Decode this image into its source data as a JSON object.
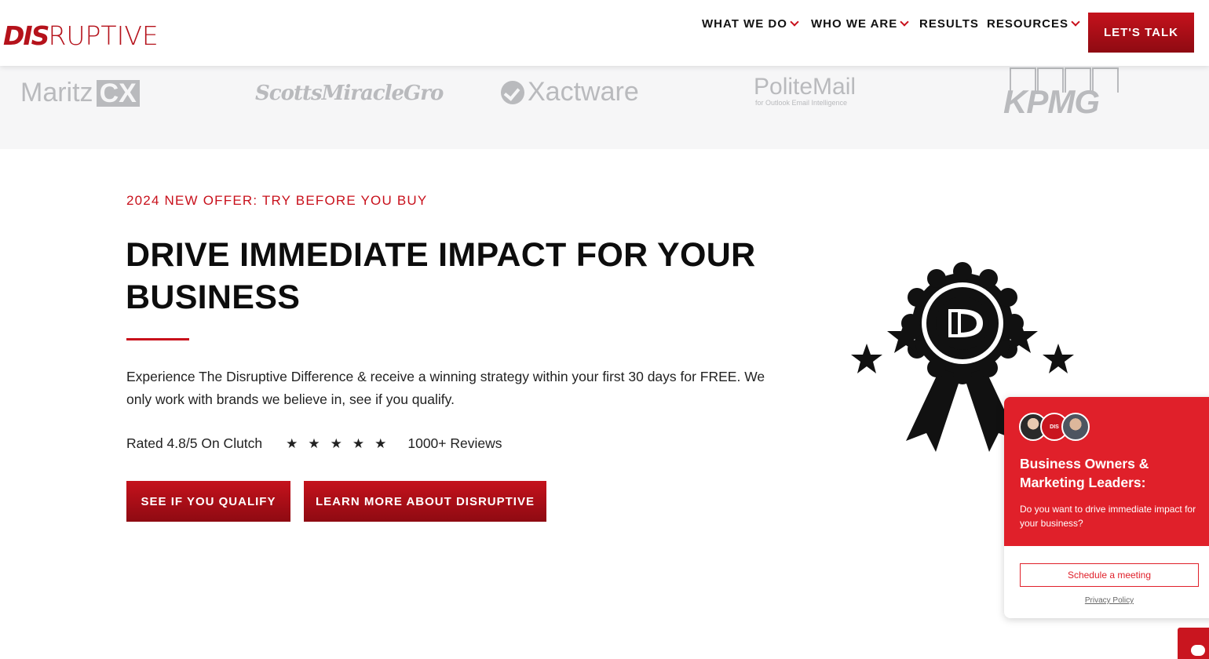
{
  "header": {
    "logo_bold": "DIS",
    "logo_light": "RUPTIVE",
    "nav": [
      {
        "label": "WHAT WE DO",
        "dropdown": true
      },
      {
        "label": "WHO WE ARE",
        "dropdown": true
      },
      {
        "label": "RESULTS",
        "dropdown": false
      },
      {
        "label": "RESOURCES",
        "dropdown": true
      }
    ],
    "cta": "LET'S TALK"
  },
  "clients": {
    "maritz": "Maritz",
    "maritz_cx": "CX",
    "scotts": "ScottsMiracleGro",
    "xactware": "Xactware",
    "politemail": "PoliteMail",
    "politemail_sub": "for Outlook Email Intelligence",
    "kpmg": "KPMG"
  },
  "main": {
    "eyebrow": "2024 NEW OFFER: TRY BEFORE YOU BUY",
    "headline": "DRIVE IMMEDIATE IMPACT FOR YOUR BUSINESS",
    "body": "Experience The Disruptive Difference & receive a winning strategy within your first 30 days for FREE. We only work with brands we believe in, see if you qualify.",
    "rating_text": "Rated 4.8/5 On Clutch",
    "stars": "★★★★★",
    "reviews": "1000+ Reviews",
    "btn_qualify": "SEE IF YOU QUALIFY",
    "btn_learn": "LEARN MORE ABOUT DISRUPTIVE"
  },
  "chat": {
    "avatar_logo": "DIS",
    "title": "Business Owners & Marketing Leaders:",
    "text": "Do you want to drive immediate impact for your business?",
    "button": "Schedule a meeting",
    "privacy": "Privacy Policy"
  },
  "colors": {
    "brand_red": "#c8101b",
    "button_gradient_top": "#c5121c",
    "button_gradient_bottom": "#8e0a12",
    "chat_red": "#e0202a"
  }
}
